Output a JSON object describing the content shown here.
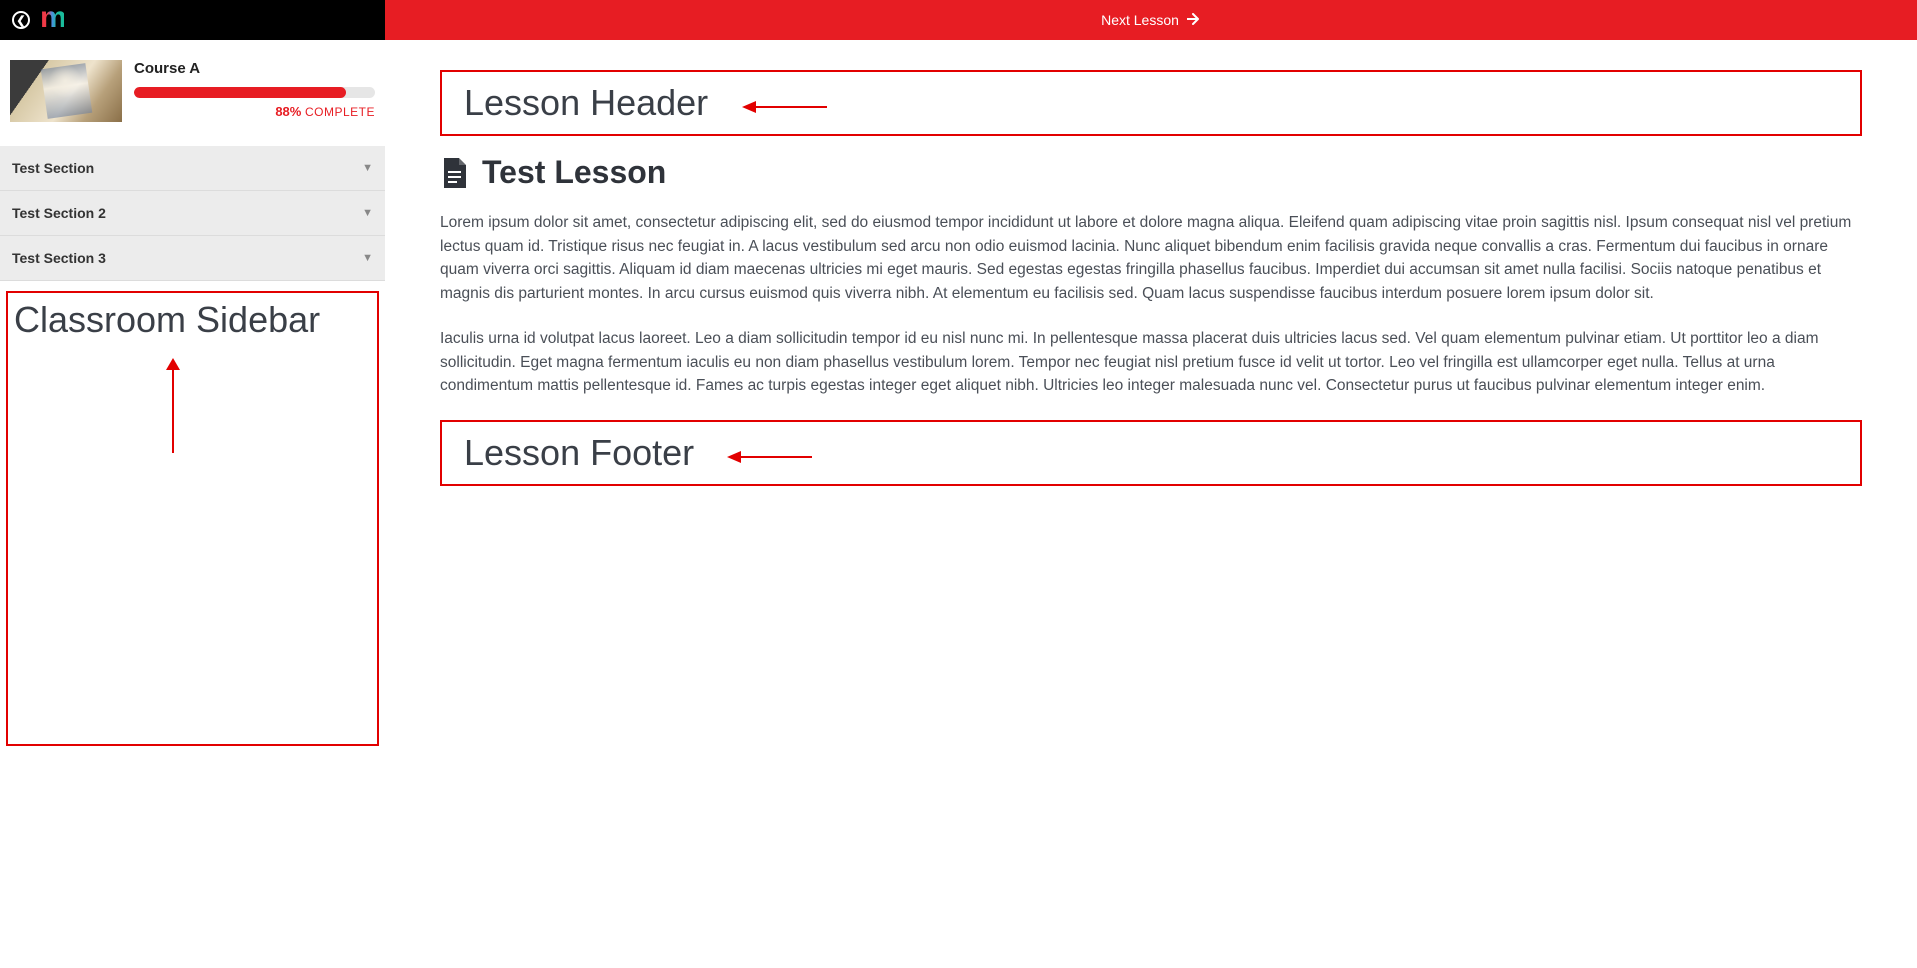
{
  "topbar": {
    "next_lesson_label": "Next Lesson"
  },
  "sidebar": {
    "course_title": "Course A",
    "progress_percent": "88%",
    "progress_word": "COMPLETE",
    "progress_value": 88,
    "sections": [
      {
        "label": "Test Section"
      },
      {
        "label": "Test Section 2"
      },
      {
        "label": "Test Section 3"
      }
    ],
    "annotation_label": "Classroom Sidebar"
  },
  "main": {
    "header_annotation": "Lesson Header",
    "lesson_title": "Test Lesson",
    "paragraph1": "Lorem ipsum dolor sit amet, consectetur adipiscing elit, sed do eiusmod tempor incididunt ut labore et dolore magna aliqua. Eleifend quam adipiscing vitae proin sagittis nisl. Ipsum consequat nisl vel pretium lectus quam id. Tristique risus nec feugiat in. A lacus vestibulum sed arcu non odio euismod lacinia. Nunc aliquet bibendum enim facilisis gravida neque convallis a cras. Fermentum dui faucibus in ornare quam viverra orci sagittis. Aliquam id diam maecenas ultricies mi eget mauris. Sed egestas egestas fringilla phasellus faucibus. Imperdiet dui accumsan sit amet nulla facilisi. Sociis natoque penatibus et magnis dis parturient montes. In arcu cursus euismod quis viverra nibh. At elementum eu facilisis sed. Quam lacus suspendisse faucibus interdum posuere lorem ipsum dolor sit.",
    "paragraph2": "Iaculis urna id volutpat lacus laoreet. Leo a diam sollicitudin tempor id eu nisl nunc mi. In pellentesque massa placerat duis ultricies lacus sed. Vel quam elementum pulvinar etiam. Ut porttitor leo a diam sollicitudin. Eget magna fermentum iaculis eu non diam phasellus vestibulum lorem. Tempor nec feugiat nisl pretium fusce id velit ut tortor. Leo vel fringilla est ullamcorper eget nulla. Tellus at urna condimentum mattis pellentesque id. Fames ac turpis egestas integer eget aliquet nibh. Ultricies leo integer malesuada nunc vel. Consectetur purus ut faucibus pulvinar elementum integer enim.",
    "footer_annotation": "Lesson Footer"
  },
  "colors": {
    "brand_red": "#e71d23",
    "annot_red": "#e20000"
  }
}
